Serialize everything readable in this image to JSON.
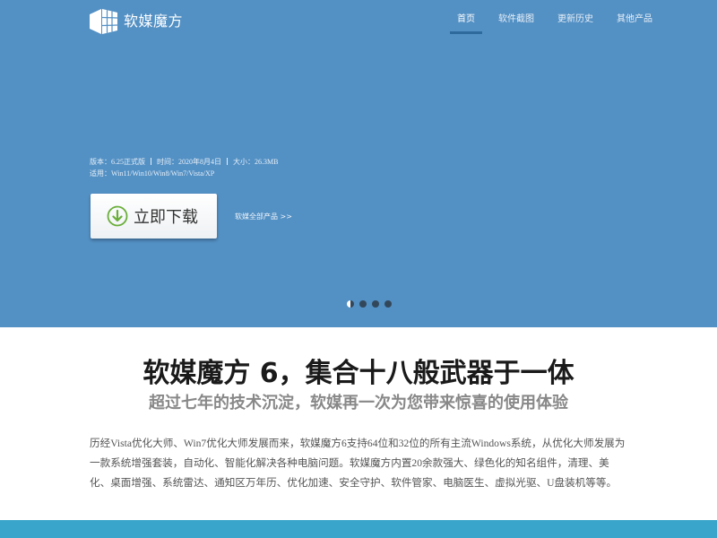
{
  "app": {
    "title": "软媒魔方"
  },
  "nav": {
    "items": [
      {
        "label": "首页",
        "active": true
      },
      {
        "label": "软件截图",
        "active": false
      },
      {
        "label": "更新历史",
        "active": false
      },
      {
        "label": "其他产品",
        "active": false
      }
    ]
  },
  "meta": {
    "version": "版本：6.25正式版",
    "date": "时间：2020年8月4日",
    "size": "大小：26.3MB",
    "os": "适用：Win11/Win10/Win8/Win7/Vista/XP"
  },
  "download": {
    "label": "立即下载"
  },
  "all_products": {
    "label": "软媒全部产品 >>"
  },
  "carousel": {
    "count": 4,
    "active_index": 0
  },
  "main": {
    "headline": "软媒魔方 6，集合十八般武器于一体",
    "subhead": "超过七年的技术沉淀，软媒再一次为您带来惊喜的使用体验",
    "description": "历经Vista优化大师、Win7优化大师发展而来，软媒魔方6支持64位和32位的所有主流Windows系统，从优化大师发展为一款系统增强套装，自动化、智能化解决各种电脑问题。软媒魔方内置20余款强大、绿色化的知名组件，清理、美化、桌面增强、系统雷达、通知区万年历、优化加速、安全守护、软件管家、电脑医生、虚拟光驱、U盘装机等等。"
  },
  "colors": {
    "hero_bg": "#5390c4",
    "nav_active_underline": "#2f6a9c",
    "download_icon": "#6aae3a",
    "footer_band": "#3aa5cb"
  },
  "icons": {
    "logo": "cube-logo-icon",
    "download": "download-arrow-icon"
  }
}
